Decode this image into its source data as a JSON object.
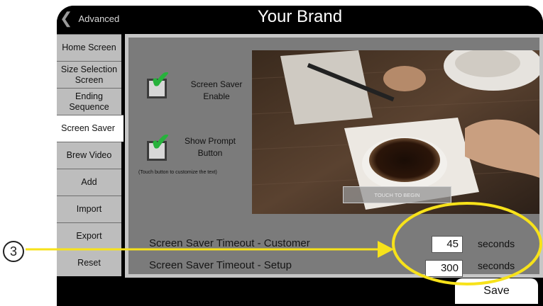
{
  "header": {
    "back_label": "Advanced",
    "title": "Your Brand"
  },
  "sidebar": {
    "tabs": [
      {
        "label": "Home Screen"
      },
      {
        "label": "Size Selection Screen"
      },
      {
        "label": "Ending Sequence"
      },
      {
        "label": "Screen Saver",
        "active": true
      },
      {
        "label": "Brew Video"
      },
      {
        "label": "Add"
      },
      {
        "label": "Import"
      },
      {
        "label": "Export"
      },
      {
        "label": "Reset"
      }
    ]
  },
  "screen_saver": {
    "enable_label": "Screen Saver Enable",
    "enable_checked": true,
    "prompt_label": "Show Prompt Button",
    "prompt_checked": true,
    "prompt_hint": "(Touch button to customize the text)",
    "preview_button": "TOUCH TO BEGIN"
  },
  "timeouts": {
    "customer_label": "Screen Saver Timeout - Customer",
    "customer_value": "45",
    "setup_label": "Screen Saver Timeout - Setup",
    "setup_value": "300",
    "unit": "seconds"
  },
  "save_label": "Save",
  "callout": {
    "number": "3",
    "color": "#f7e21a"
  },
  "colors": {
    "check": "#27b23c",
    "highlight": "#f7e21a",
    "panel": "#7b7b7b",
    "tab": "#bdbdbd"
  }
}
